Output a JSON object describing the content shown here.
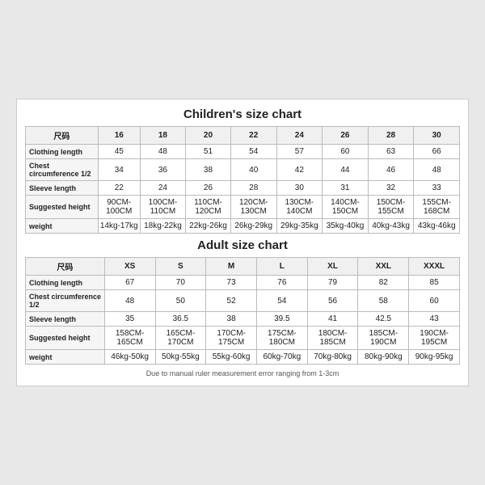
{
  "children_chart": {
    "title": "Children's size chart",
    "columns": [
      "尺码",
      "16",
      "18",
      "20",
      "22",
      "24",
      "26",
      "28",
      "30"
    ],
    "rows": [
      {
        "label": "Clothing length",
        "values": [
          "45",
          "48",
          "51",
          "54",
          "57",
          "60",
          "63",
          "66"
        ]
      },
      {
        "label": "Chest circumference 1/2",
        "values": [
          "34",
          "36",
          "38",
          "40",
          "42",
          "44",
          "46",
          "48"
        ]
      },
      {
        "label": "Sleeve length",
        "values": [
          "22",
          "24",
          "26",
          "28",
          "30",
          "31",
          "32",
          "33"
        ]
      },
      {
        "label": "Suggested height",
        "values": [
          "90CM-100CM",
          "100CM-110CM",
          "110CM-120CM",
          "120CM-130CM",
          "130CM-140CM",
          "140CM-150CM",
          "150CM-155CM",
          "155CM-168CM"
        ]
      },
      {
        "label": "weight",
        "values": [
          "14kg-17kg",
          "18kg-22kg",
          "22kg-26kg",
          "26kg-29kg",
          "29kg-35kg",
          "35kg-40kg",
          "40kg-43kg",
          "43kg-46kg"
        ]
      }
    ]
  },
  "adult_chart": {
    "title": "Adult size chart",
    "columns": [
      "尺码",
      "XS",
      "S",
      "M",
      "L",
      "XL",
      "XXL",
      "XXXL"
    ],
    "rows": [
      {
        "label": "Clothing length",
        "values": [
          "67",
          "70",
          "73",
          "76",
          "79",
          "82",
          "85"
        ]
      },
      {
        "label": "Chest circumference 1/2",
        "values": [
          "48",
          "50",
          "52",
          "54",
          "56",
          "58",
          "60"
        ]
      },
      {
        "label": "Sleeve length",
        "values": [
          "35",
          "36.5",
          "38",
          "39.5",
          "41",
          "42.5",
          "43"
        ]
      },
      {
        "label": "Suggested height",
        "values": [
          "158CM-165CM",
          "165CM-170CM",
          "170CM-175CM",
          "175CM-180CM",
          "180CM-185CM",
          "185CM-190CM",
          "190CM-195CM"
        ]
      },
      {
        "label": "weight",
        "values": [
          "46kg-50kg",
          "50kg-55kg",
          "55kg-60kg",
          "60kg-70kg",
          "70kg-80kg",
          "80kg-90kg",
          "90kg-95kg"
        ]
      }
    ]
  },
  "footer_note": "Due to manual ruler measurement error ranging from 1-3cm"
}
